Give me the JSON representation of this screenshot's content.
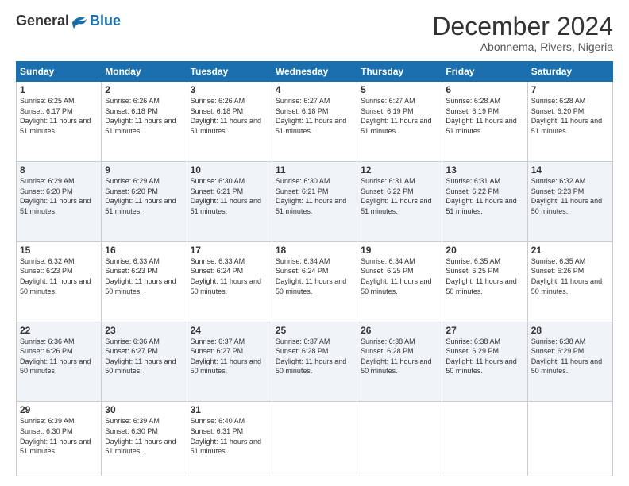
{
  "header": {
    "logo_general": "General",
    "logo_blue": "Blue",
    "month_title": "December 2024",
    "location": "Abonnema, Rivers, Nigeria"
  },
  "days_of_week": [
    "Sunday",
    "Monday",
    "Tuesday",
    "Wednesday",
    "Thursday",
    "Friday",
    "Saturday"
  ],
  "weeks": [
    [
      {
        "day": "1",
        "sunrise": "6:25 AM",
        "sunset": "6:17 PM",
        "daylight": "11 hours and 51 minutes."
      },
      {
        "day": "2",
        "sunrise": "6:26 AM",
        "sunset": "6:18 PM",
        "daylight": "11 hours and 51 minutes."
      },
      {
        "day": "3",
        "sunrise": "6:26 AM",
        "sunset": "6:18 PM",
        "daylight": "11 hours and 51 minutes."
      },
      {
        "day": "4",
        "sunrise": "6:27 AM",
        "sunset": "6:18 PM",
        "daylight": "11 hours and 51 minutes."
      },
      {
        "day": "5",
        "sunrise": "6:27 AM",
        "sunset": "6:19 PM",
        "daylight": "11 hours and 51 minutes."
      },
      {
        "day": "6",
        "sunrise": "6:28 AM",
        "sunset": "6:19 PM",
        "daylight": "11 hours and 51 minutes."
      },
      {
        "day": "7",
        "sunrise": "6:28 AM",
        "sunset": "6:20 PM",
        "daylight": "11 hours and 51 minutes."
      }
    ],
    [
      {
        "day": "8",
        "sunrise": "6:29 AM",
        "sunset": "6:20 PM",
        "daylight": "11 hours and 51 minutes."
      },
      {
        "day": "9",
        "sunrise": "6:29 AM",
        "sunset": "6:20 PM",
        "daylight": "11 hours and 51 minutes."
      },
      {
        "day": "10",
        "sunrise": "6:30 AM",
        "sunset": "6:21 PM",
        "daylight": "11 hours and 51 minutes."
      },
      {
        "day": "11",
        "sunrise": "6:30 AM",
        "sunset": "6:21 PM",
        "daylight": "11 hours and 51 minutes."
      },
      {
        "day": "12",
        "sunrise": "6:31 AM",
        "sunset": "6:22 PM",
        "daylight": "11 hours and 51 minutes."
      },
      {
        "day": "13",
        "sunrise": "6:31 AM",
        "sunset": "6:22 PM",
        "daylight": "11 hours and 51 minutes."
      },
      {
        "day": "14",
        "sunrise": "6:32 AM",
        "sunset": "6:23 PM",
        "daylight": "11 hours and 50 minutes."
      }
    ],
    [
      {
        "day": "15",
        "sunrise": "6:32 AM",
        "sunset": "6:23 PM",
        "daylight": "11 hours and 50 minutes."
      },
      {
        "day": "16",
        "sunrise": "6:33 AM",
        "sunset": "6:23 PM",
        "daylight": "11 hours and 50 minutes."
      },
      {
        "day": "17",
        "sunrise": "6:33 AM",
        "sunset": "6:24 PM",
        "daylight": "11 hours and 50 minutes."
      },
      {
        "day": "18",
        "sunrise": "6:34 AM",
        "sunset": "6:24 PM",
        "daylight": "11 hours and 50 minutes."
      },
      {
        "day": "19",
        "sunrise": "6:34 AM",
        "sunset": "6:25 PM",
        "daylight": "11 hours and 50 minutes."
      },
      {
        "day": "20",
        "sunrise": "6:35 AM",
        "sunset": "6:25 PM",
        "daylight": "11 hours and 50 minutes."
      },
      {
        "day": "21",
        "sunrise": "6:35 AM",
        "sunset": "6:26 PM",
        "daylight": "11 hours and 50 minutes."
      }
    ],
    [
      {
        "day": "22",
        "sunrise": "6:36 AM",
        "sunset": "6:26 PM",
        "daylight": "11 hours and 50 minutes."
      },
      {
        "day": "23",
        "sunrise": "6:36 AM",
        "sunset": "6:27 PM",
        "daylight": "11 hours and 50 minutes."
      },
      {
        "day": "24",
        "sunrise": "6:37 AM",
        "sunset": "6:27 PM",
        "daylight": "11 hours and 50 minutes."
      },
      {
        "day": "25",
        "sunrise": "6:37 AM",
        "sunset": "6:28 PM",
        "daylight": "11 hours and 50 minutes."
      },
      {
        "day": "26",
        "sunrise": "6:38 AM",
        "sunset": "6:28 PM",
        "daylight": "11 hours and 50 minutes."
      },
      {
        "day": "27",
        "sunrise": "6:38 AM",
        "sunset": "6:29 PM",
        "daylight": "11 hours and 50 minutes."
      },
      {
        "day": "28",
        "sunrise": "6:38 AM",
        "sunset": "6:29 PM",
        "daylight": "11 hours and 50 minutes."
      }
    ],
    [
      {
        "day": "29",
        "sunrise": "6:39 AM",
        "sunset": "6:30 PM",
        "daylight": "11 hours and 51 minutes."
      },
      {
        "day": "30",
        "sunrise": "6:39 AM",
        "sunset": "6:30 PM",
        "daylight": "11 hours and 51 minutes."
      },
      {
        "day": "31",
        "sunrise": "6:40 AM",
        "sunset": "6:31 PM",
        "daylight": "11 hours and 51 minutes."
      },
      null,
      null,
      null,
      null
    ]
  ]
}
